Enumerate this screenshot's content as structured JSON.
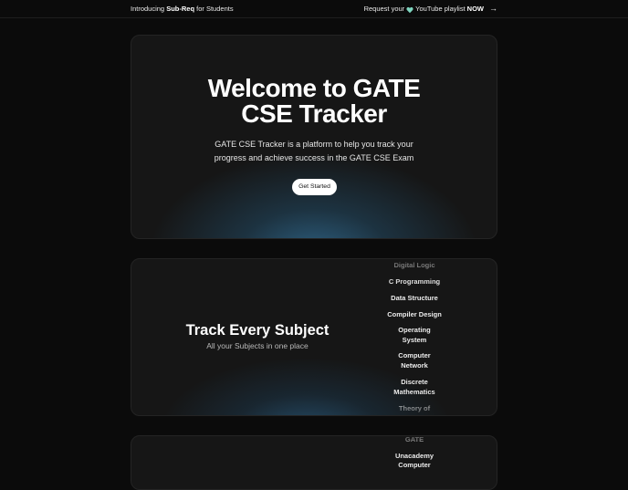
{
  "topbar": {
    "left_prefix": "Introducing ",
    "left_bold": "Sub-Req",
    "left_suffix": " for Students",
    "right_prefix": "Request your ",
    "right_mid": "YouTube playlist ",
    "right_bold": "NOW",
    "heart_color": "#7fd6c0",
    "icons": [
      "heart-icon",
      "arrow-right-icon"
    ]
  },
  "hero": {
    "title_line1": "Welcome to GATE",
    "title_line2": "CSE Tracker",
    "subtitle_line1": "GATE CSE Tracker is a platform to help you track your",
    "subtitle_line2": "progress and achieve success in the GATE CSE Exam",
    "button_label": "Get Started",
    "glow_color": "#2e6284"
  },
  "subjects": {
    "title": "Track Every Subject",
    "subtitle": "All your Subjects in one place",
    "items": [
      {
        "line1": "Digital Logic",
        "line2": ""
      },
      {
        "line1": "C Programming",
        "line2": ""
      },
      {
        "line1": "Data Structure",
        "line2": ""
      },
      {
        "line1": "Compiler Design",
        "line2": ""
      },
      {
        "line1": "Operating",
        "line2": "System"
      },
      {
        "line1": "Computer",
        "line2": "Network"
      },
      {
        "line1": "Discrete",
        "line2": "Mathematics"
      },
      {
        "line1": "Theory of",
        "line2": ""
      }
    ]
  },
  "third": {
    "items": [
      {
        "line1": "GATE",
        "line2": ""
      },
      {
        "line1": "Unacademy",
        "line2": ""
      },
      {
        "line1": "Computer",
        "line2": ""
      }
    ]
  }
}
